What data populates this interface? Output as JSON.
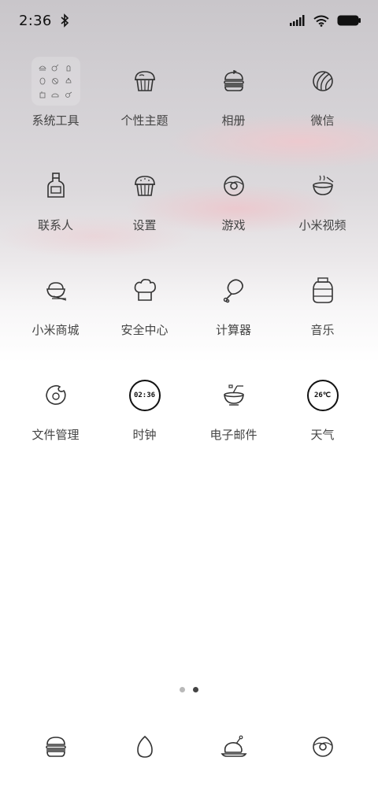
{
  "status_bar": {
    "time": "2:36",
    "icons": [
      "bluetooth-icon",
      "signal-icon",
      "wifi-icon",
      "battery-icon"
    ]
  },
  "apps": [
    {
      "label": "系统工具",
      "icon": "folder-icon"
    },
    {
      "label": "个性主题",
      "icon": "cupcake-icon"
    },
    {
      "label": "相册",
      "icon": "burger-icon"
    },
    {
      "label": "微信",
      "icon": "watermelon-icon"
    },
    {
      "label": "联系人",
      "icon": "bottle-icon"
    },
    {
      "label": "设置",
      "icon": "cupcake-icon"
    },
    {
      "label": "游戏",
      "icon": "donut-icon"
    },
    {
      "label": "小米视频",
      "icon": "bowl-icon"
    },
    {
      "label": "小米商城",
      "icon": "rice-bowl-icon"
    },
    {
      "label": "安全中心",
      "icon": "chef-hat-icon"
    },
    {
      "label": "计算器",
      "icon": "drumstick-icon"
    },
    {
      "label": "音乐",
      "icon": "honey-jar-icon"
    },
    {
      "label": "文件管理",
      "icon": "bitten-donut-icon"
    },
    {
      "label": "时钟",
      "icon": "clock-icon",
      "value": "02:36"
    },
    {
      "label": "电子邮件",
      "icon": "mixing-bowl-icon"
    },
    {
      "label": "天气",
      "icon": "weather-icon",
      "value": "26℃"
    }
  ],
  "page_indicator": {
    "count": 2,
    "active": 2
  },
  "dock": [
    {
      "icon": "burger-icon"
    },
    {
      "icon": "egg-icon"
    },
    {
      "icon": "roast-chicken-icon"
    },
    {
      "icon": "donut-icon"
    }
  ]
}
